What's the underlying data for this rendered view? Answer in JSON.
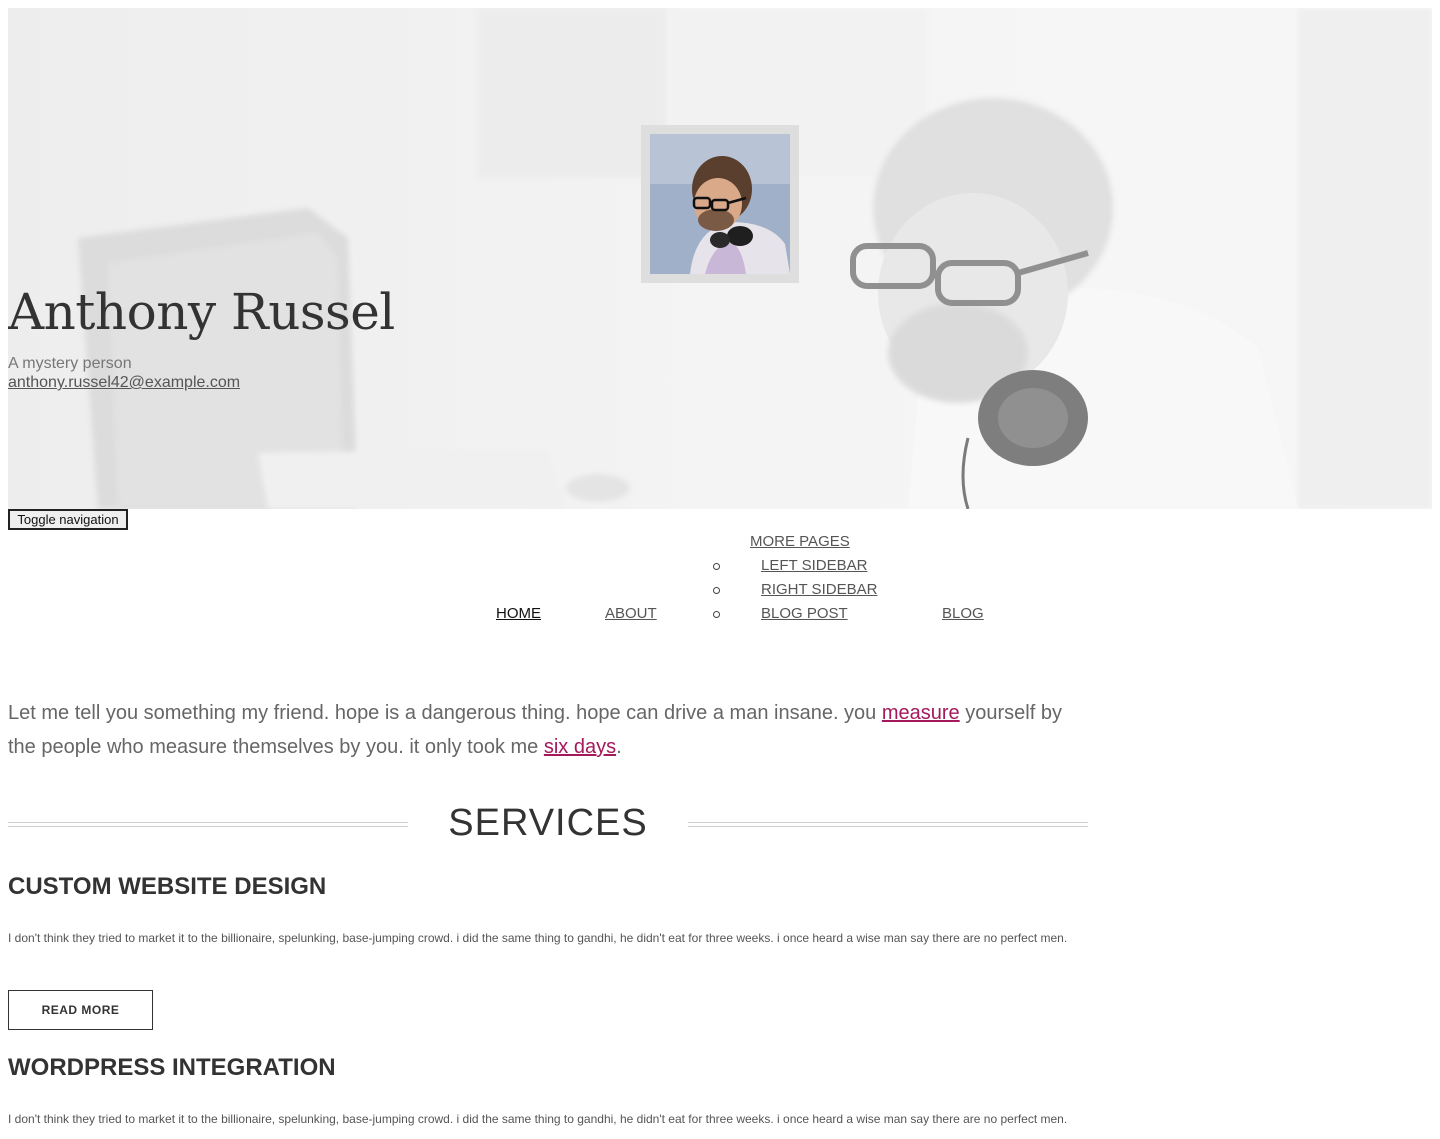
{
  "hero": {
    "name": "Anthony Russel",
    "tagline": "A mystery person",
    "email": "anthony.russel42@example.com"
  },
  "nav": {
    "toggle_label": "Toggle navigation",
    "home": "HOME",
    "about": "ABOUT",
    "more_pages": "MORE PAGES",
    "submenu": [
      "LEFT SIDEBAR",
      "RIGHT SIDEBAR",
      "BLOG POST"
    ],
    "blog": "BLOG"
  },
  "intro": {
    "part1": "Let me tell you something my friend. hope is a dangerous thing. hope can drive a man insane. you ",
    "link1": "measure",
    "part2": " yourself by the people who measure themselves by you. it only took me ",
    "link2": "six days",
    "part3": "."
  },
  "services": {
    "title": "SERVICES",
    "items": [
      {
        "title": "CUSTOM WEBSITE DESIGN",
        "text": "I don't think they tried to market it to the billionaire, spelunking, base-jumping crowd. i did the same thing to gandhi, he didn't eat for three weeks. i once heard a wise man say there are no perfect men.",
        "button": "READ MORE"
      },
      {
        "title": "WORDPRESS INTEGRATION",
        "text": "I don't think they tried to market it to the billionaire, spelunking, base-jumping crowd. i did the same thing to gandhi, he didn't eat for three weeks. i once heard a wise man say there are no perfect men."
      }
    ]
  }
}
